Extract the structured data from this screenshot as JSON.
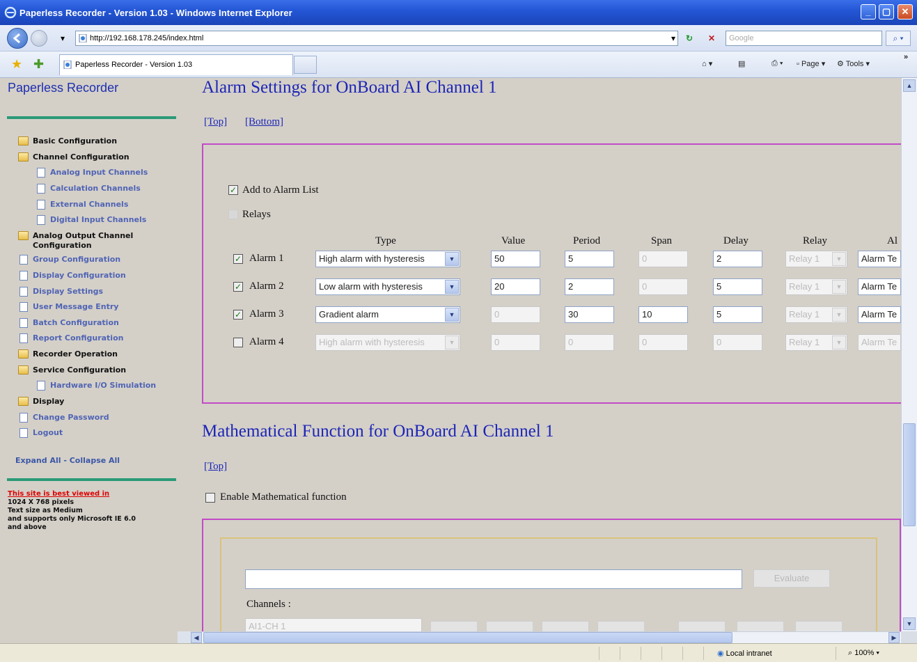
{
  "window": {
    "title": "Paperless Recorder - Version 1.03 - Windows Internet Explorer"
  },
  "address": {
    "url": "http://192.168.178.245/index.html",
    "search_placeholder": "Google"
  },
  "tabs": {
    "active_label": "Paperless Recorder - Version 1.03"
  },
  "toolbar": {
    "page_label": "Page",
    "tools_label": "Tools"
  },
  "sidebar": {
    "title": "Paperless Recorder",
    "items": [
      {
        "label": "Basic Configuration",
        "kind": "folder"
      },
      {
        "label": "Channel Configuration",
        "kind": "folder"
      },
      {
        "label": "Analog Input Channels",
        "kind": "page"
      },
      {
        "label": "Calculation Channels",
        "kind": "page"
      },
      {
        "label": "External Channels",
        "kind": "page"
      },
      {
        "label": "Digital Input Channels",
        "kind": "page"
      },
      {
        "label": "Analog Output Channel",
        "label2": "Configuration",
        "kind": "folder"
      },
      {
        "label": "Group Configuration",
        "kind": "page"
      },
      {
        "label": "Display Configuration",
        "kind": "page"
      },
      {
        "label": "Display Settings",
        "kind": "page"
      },
      {
        "label": "User Message Entry",
        "kind": "page"
      },
      {
        "label": "Batch Configuration",
        "kind": "page"
      },
      {
        "label": "Report Configuration",
        "kind": "page"
      },
      {
        "label": "Recorder Operation",
        "kind": "folder"
      },
      {
        "label": "Service Configuration",
        "kind": "folder"
      },
      {
        "label": "Hardware I/O Simulation",
        "kind": "page"
      },
      {
        "label": "Display",
        "kind": "folder"
      },
      {
        "label": "Change Password",
        "kind": "page"
      },
      {
        "label": "Logout",
        "kind": "page"
      }
    ],
    "expand_collapse": "Expand All - Collapse All",
    "best_viewed_link": "This site is best viewed in",
    "best_viewed_lines": [
      "1024 X 768 pixels",
      "Text size as Medium",
      "and supports only Microsoft IE 6.0",
      "and above"
    ]
  },
  "alarm_section": {
    "title": "Alarm Settings for OnBoard AI Channel 1",
    "top_link": "[Top]",
    "bottom_link": "[Bottom]",
    "add_to_alarm_list": "Add to Alarm List",
    "relays_label": "Relays",
    "columns": [
      "Type",
      "Value",
      "Period",
      "Span",
      "Delay",
      "Relay",
      "Al"
    ],
    "rows": [
      {
        "label": "Alarm 1",
        "checked": true,
        "type": "High alarm with hysteresis",
        "value": "50",
        "period": "5",
        "span": "0",
        "delay": "2",
        "relay": "Relay 1",
        "alarm_text": "Alarm Te",
        "enabled": true,
        "span_enabled": false
      },
      {
        "label": "Alarm 2",
        "checked": true,
        "type": "Low alarm with hysteresis",
        "value": "20",
        "period": "2",
        "span": "0",
        "delay": "5",
        "relay": "Relay 1",
        "alarm_text": "Alarm Te",
        "enabled": true,
        "span_enabled": false
      },
      {
        "label": "Alarm 3",
        "checked": true,
        "type": "Gradient alarm",
        "value": "0",
        "period": "30",
        "span": "10",
        "delay": "5",
        "relay": "Relay 1",
        "alarm_text": "Alarm Te",
        "enabled": true,
        "span_enabled": true
      },
      {
        "label": "Alarm 4",
        "checked": false,
        "type": "High alarm with hysteresis",
        "value": "0",
        "period": "0",
        "span": "0",
        "delay": "0",
        "relay": "Relay 1",
        "alarm_text": "Alarm Te",
        "enabled": false,
        "span_enabled": false
      }
    ]
  },
  "math_section": {
    "title": "Mathematical Function for OnBoard AI Channel 1",
    "top_link": "[Top]",
    "enable_label": "Enable Mathematical function",
    "evaluate_label": "Evaluate",
    "channels_label": "Channels :",
    "channel_select": "AI1-CH 1"
  },
  "status": {
    "zone": "Local intranet",
    "zoom": "100%"
  }
}
